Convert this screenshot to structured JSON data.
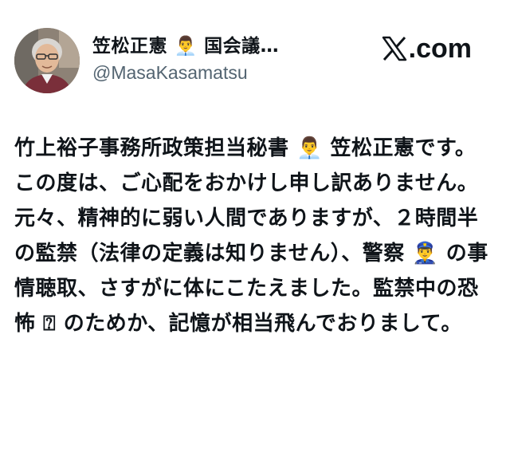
{
  "author": {
    "display_name": "笠松正憲 👨‍💼 国会議…",
    "handle": "@MasaKasamatsu",
    "avatar_icon": "person-photo"
  },
  "brand": {
    "text": ".com",
    "icon": "x-logo-icon"
  },
  "tweet": {
    "paragraphs": [
      "竹上裕子事務所政策担当秘書 👨‍💼 笠松正憲です。",
      "この度は、ご心配をおかけし申し訳ありません。",
      "元々、精神的に弱い人間でありますが、２時間半の監禁（法律の定義は知りません）、警察 👮‍♂️ の事情聴取、さすがに体にこたえました。監禁中の恐怖 ⍰ のためか、記憶が相当飛んでおりまして。"
    ]
  },
  "colors": {
    "text": "#0f1419",
    "secondary": "#536471",
    "background": "#ffffff"
  }
}
